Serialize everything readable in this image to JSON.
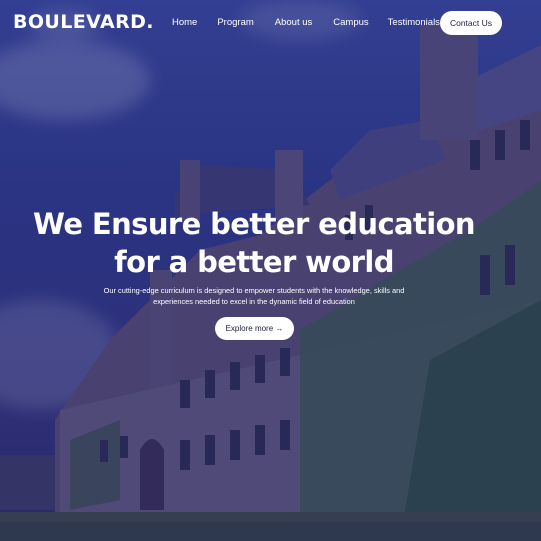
{
  "brand": {
    "name": "BOULEVARD."
  },
  "nav": {
    "items": [
      "Home",
      "Program",
      "About us",
      "Campus",
      "Testimonials"
    ],
    "contact_label": "Contact Us"
  },
  "hero": {
    "headline_line1": "We Ensure better education",
    "headline_line2": "for a better world",
    "subtext_line1": "Our cutting-edge curriculum is designed to empower students with the knowledge, skills and",
    "subtext_line2": "experiences needed to excel in the dynamic field of education",
    "cta_label": "Explore more →"
  },
  "colors": {
    "overlay": "#2a2c7a",
    "button_bg": "#ffffff",
    "text": "#ffffff"
  }
}
